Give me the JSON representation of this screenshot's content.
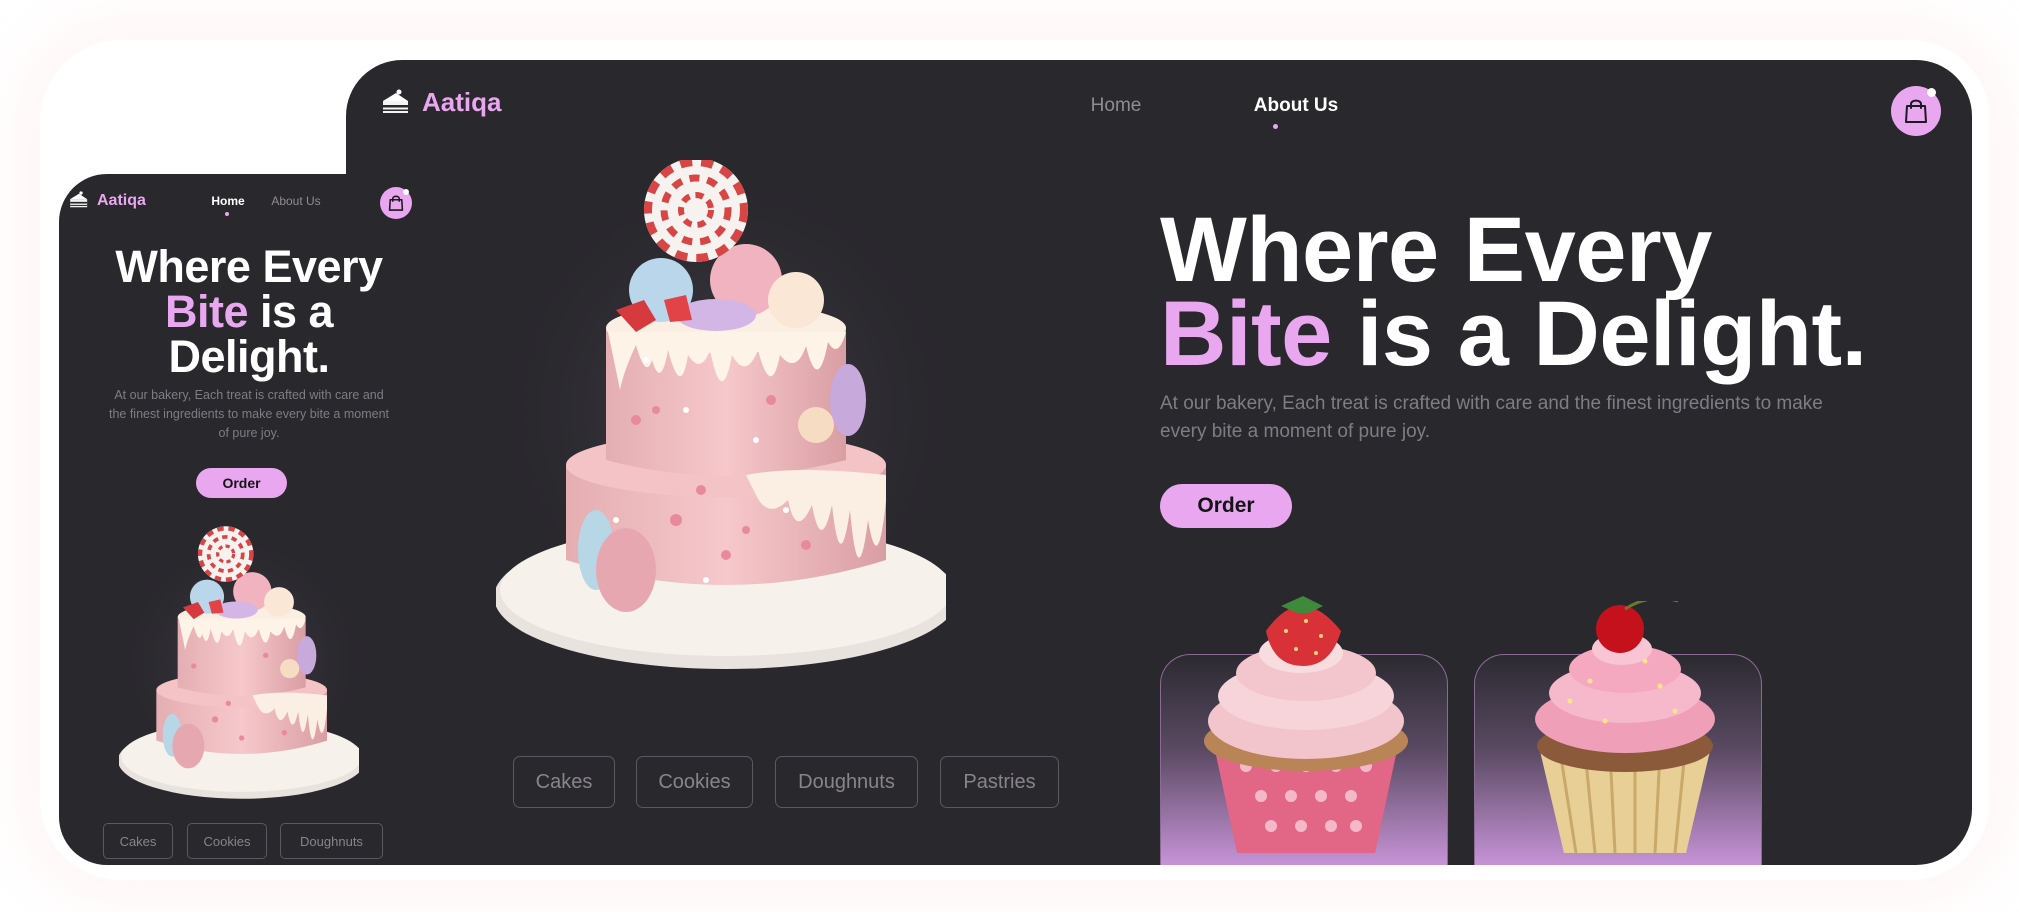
{
  "brand": {
    "name": "Aatiqa"
  },
  "desktop": {
    "nav": {
      "home": "Home",
      "about": "About Us",
      "active": "About Us"
    },
    "hero": {
      "title_line1": "Where Every",
      "title_highlight": "Bite",
      "title_rest": " is a Delight.",
      "description": "At our bakery, Each treat is crafted with care and the finest ingredients to make every bite a moment of pure joy.",
      "order_label": "Order"
    },
    "categories": [
      "Cakes",
      "Cookies",
      "Doughnuts",
      "Pastries"
    ]
  },
  "mobile": {
    "nav": {
      "home": "Home",
      "about": "About Us",
      "active": "Home"
    },
    "hero": {
      "title_line1": "Where Every",
      "title_highlight": "Bite",
      "title_rest": " is a",
      "title_line3": "Delight.",
      "description": "At our bakery, Each treat is crafted with care and the finest ingredients to make every bite a moment of pure joy.",
      "order_label": "Order"
    },
    "categories": [
      "Cakes",
      "Cookies",
      "Doughnuts"
    ]
  },
  "icons": {
    "logo": "cake-slice-icon",
    "cart": "shopping-bag-icon"
  },
  "colors": {
    "accent": "#e8a7ef",
    "background": "#29282d",
    "text": "#ffffff",
    "muted": "#7f7d84"
  }
}
